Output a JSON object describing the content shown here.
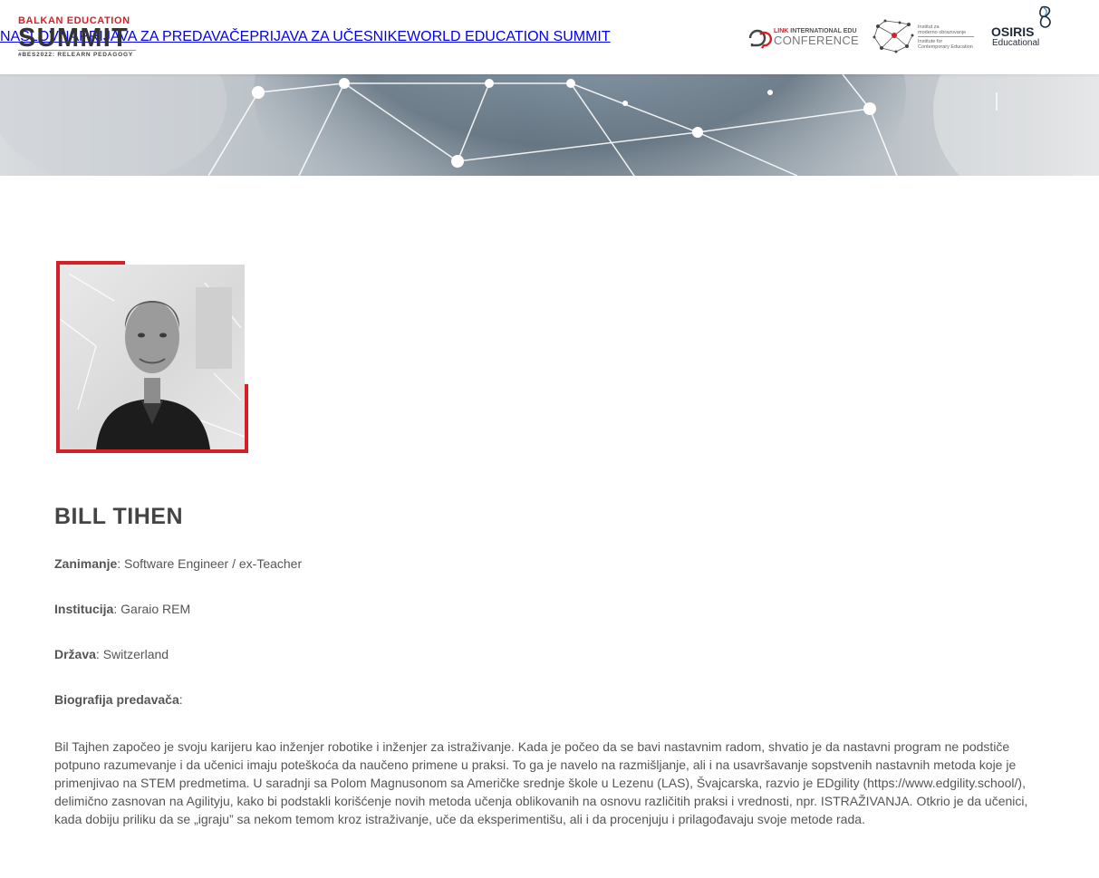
{
  "header": {
    "logo": {
      "top": "BALKAN EDUCATION",
      "main": "SUMMIT",
      "sub": "#BES2022: RELEARN PEDAGOGY"
    },
    "nav": [
      {
        "label": "NASLOVNA"
      },
      {
        "label": "PRIJAVA ZA PREDAVAČE"
      },
      {
        "label": "PRIJAVA ZA UČESNIKE"
      },
      {
        "label": "WORLD EDUCATION SUMMIT"
      }
    ],
    "partners": {
      "link": {
        "small_brand": "LINK",
        "small_rest": " INTERNATIONAL EDU",
        "big": "CONFERENCE"
      },
      "iso": {
        "line1": "Institut za",
        "line2": "moderno obrazovanje",
        "line3": "Institute for",
        "line4": "Contemporary Education"
      },
      "osiris": {
        "line1": "OSIRIS",
        "line2": "Educational"
      }
    }
  },
  "speaker": {
    "name": "BILL TIHEN",
    "fields": [
      {
        "key": "Zanimanje",
        "value": ": Software Engineer / ex-Teacher"
      },
      {
        "key": "Institucija",
        "value": ": Garaio REM"
      },
      {
        "key": "Država",
        "value": ": Switzerland"
      },
      {
        "key": "Biografija predavača",
        "value": ":"
      }
    ],
    "bio": "Bil Tajhen započeo je svoju karijeru kao inženjer robotike i inženjer za istraživanje. Kada je počeo da se bavi nastavnim radom, shvatio je da nastavni program ne podstiče potpuno razumevanje i da učenici imaju poteškoća da naučeno primene u praksi. To ga je navelo na razmišljanje, ali i na usavršavanje sopstvenih nastavnih metoda koje je primenjivao na STEM predmetima. U saradnji sa Polom Magnusonom sa Američke srednje škole u Lezenu (LAS), Švajcarska, razvio je EDgility (https://www.edgility.school/), delimično zasnovan na Agilityju, kako bi podstakli korišćenje novih metoda učenja oblikovanih na osnovu različitih praksi i vrednosti, npr. ISTRAŽIVANJA. Otkrio je da učenici, kada dobiju priliku da se „igraju” sa nekom temom kroz istraživanje, uče da eksperimentišu, ali i da procenjuju i prilagođavaju svoje metode rada."
  },
  "colors": {
    "accent": "#d42027",
    "text": "#555555",
    "heading": "#444444"
  }
}
